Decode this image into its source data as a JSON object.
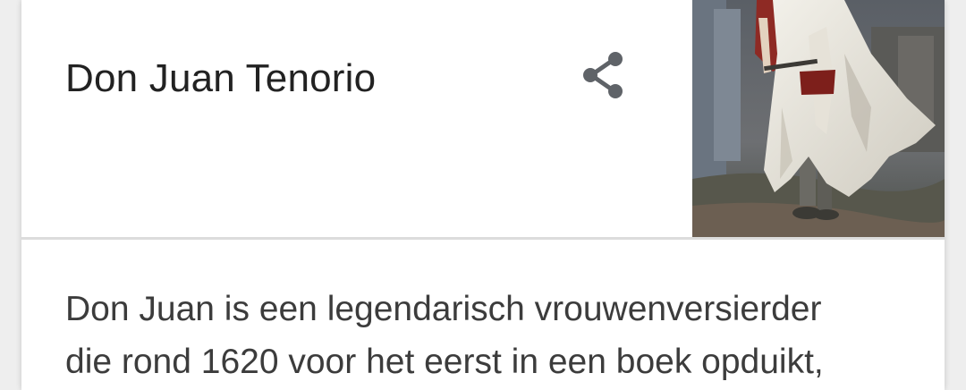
{
  "card": {
    "title": "Don Juan Tenorio",
    "share_icon": "share-icon",
    "image_alt": "painting",
    "description_lines": [
      "Don Juan is een legendarisch vrouwenversierder",
      "die rond 1620 voor het eerst in een boek opduikt,"
    ]
  },
  "colors": {
    "title": "#222222",
    "body_text": "#3c3c3c",
    "icon": "#5f6368",
    "divider": "#dcdcdc"
  }
}
